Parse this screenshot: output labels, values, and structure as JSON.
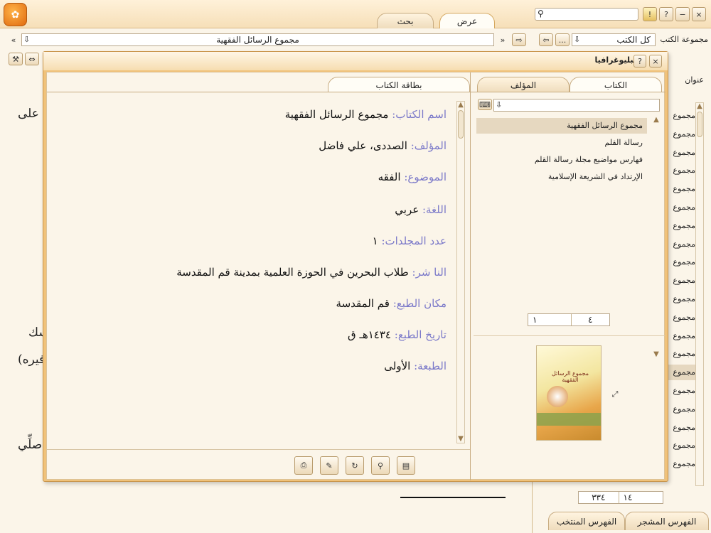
{
  "window": {
    "tabs": [
      "عرض",
      "بحث"
    ],
    "search_placeholder": ""
  },
  "toolbar": {
    "book_title": "مجموع الرسائل الفقهية",
    "collection_label": "مجموعة الكتب",
    "collection_value": "كل الكتب",
    "more_label": "..."
  },
  "right_panel": {
    "header": "عنوان",
    "items": [
      "مجموع",
      "مجموع",
      "مجموع",
      "مجموع",
      "مجموع",
      "مجموع",
      "مجموع",
      "مجموع",
      "مجموع",
      "مجموع",
      "مجموع",
      "مجموع",
      "مجموع",
      "مجموع",
      "مجموع",
      "مجموع",
      "مجموع",
      "مجموع",
      "مجموع",
      "مجموع"
    ],
    "pager_total": "٣٣٤",
    "pager_current": "١٤",
    "bottom_tabs": [
      "الفهرس المشجر",
      "الفهرس المنتخب"
    ]
  },
  "background_text": {
    "frag1": "على",
    "frag2": "سك",
    "frag3": "فيره)",
    "frag4": "صلِّي"
  },
  "dialog": {
    "title": "ببليوغرافيا",
    "help": "?",
    "close": "×",
    "left_tabs": [
      "الكتاب",
      "المؤلف"
    ],
    "card_tab": "بطاقة الكتاب",
    "list": [
      "مجموع الرسائل الفقهية",
      "رسالة القلم",
      "فهارس مواضيع مجلة رسالة القلم",
      "الإرتداد في الشريعة الإسلامية"
    ],
    "pager_total": "٤",
    "pager_current": "١",
    "card": [
      {
        "label": "اسم الكتاب:",
        "value": "مجموع الرسائل الفقهية"
      },
      {
        "label": "المؤلف:",
        "value": "الصددى، علي فاضل"
      },
      {
        "label": "الموضوع:",
        "value": "الفقه"
      },
      {
        "label": "اللغة:",
        "value": "عربي"
      },
      {
        "label": "عدد المجلدات:",
        "value": "١"
      },
      {
        "label": "النا شر:",
        "value": "طلاب البحرين في الحوزة العلمية بمدينة قم المقدسة"
      },
      {
        "label": "مكان الطبع:",
        "value": "قم المقدسة"
      },
      {
        "label": "تاريخ الطبع:",
        "value": "١٤٣٤هـ ق"
      },
      {
        "label": "الطبعة:",
        "value": "الأولى"
      }
    ],
    "cover_title": "مجموع الرسائل الفقهية"
  },
  "colors": {
    "accent": "#f0c27a",
    "frame": "#e9b96e",
    "label": "#7b79c9"
  }
}
